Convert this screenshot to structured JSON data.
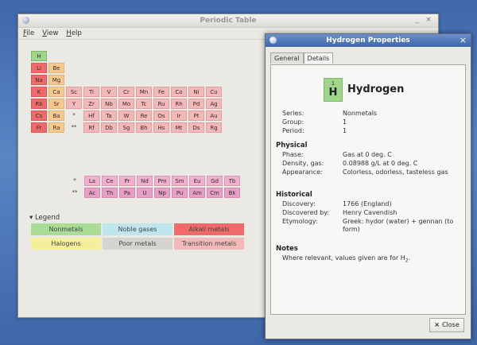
{
  "main_window": {
    "title": "Periodic Table",
    "menu": [
      "File",
      "View",
      "Help"
    ],
    "min_glyph": "_",
    "close_glyph": "×"
  },
  "table": {
    "rows": [
      [
        [
          "H",
          "nonmetal"
        ]
      ],
      [
        [
          "Li",
          "alkali"
        ],
        [
          "Be",
          "alkaline"
        ]
      ],
      [
        [
          "Na",
          "alkali"
        ],
        [
          "Mg",
          "alkaline"
        ]
      ],
      [
        [
          "K",
          "alkali"
        ],
        [
          "Ca",
          "alkaline"
        ],
        [
          "Sc",
          "transition"
        ],
        [
          "Ti",
          "transition"
        ],
        [
          "V",
          "transition"
        ],
        [
          "Cr",
          "transition"
        ],
        [
          "Mn",
          "transition"
        ],
        [
          "Fe",
          "transition"
        ],
        [
          "Co",
          "transition"
        ],
        [
          "Ni",
          "transition"
        ],
        [
          "Cu",
          "transition"
        ]
      ],
      [
        [
          "Rb",
          "alkali"
        ],
        [
          "Sr",
          "alkaline"
        ],
        [
          "Y",
          "transition"
        ],
        [
          "Zr",
          "transition"
        ],
        [
          "Nb",
          "transition"
        ],
        [
          "Mo",
          "transition"
        ],
        [
          "Tc",
          "transition"
        ],
        [
          "Ru",
          "transition"
        ],
        [
          "Rh",
          "transition"
        ],
        [
          "Pd",
          "transition"
        ],
        [
          "Ag",
          "transition"
        ]
      ],
      [
        [
          "Cs",
          "alkali"
        ],
        [
          "Ba",
          "alkaline"
        ],
        [
          "*",
          "blank"
        ],
        [
          "Hf",
          "transition"
        ],
        [
          "Ta",
          "transition"
        ],
        [
          "W",
          "transition"
        ],
        [
          "Re",
          "transition"
        ],
        [
          "Os",
          "transition"
        ],
        [
          "Ir",
          "transition"
        ],
        [
          "Pt",
          "transition"
        ],
        [
          "Au",
          "transition"
        ]
      ],
      [
        [
          "Fr",
          "alkali"
        ],
        [
          "Ra",
          "alkaline"
        ],
        [
          "**",
          "blank"
        ],
        [
          "Rf",
          "transition"
        ],
        [
          "Db",
          "transition"
        ],
        [
          "Sg",
          "transition"
        ],
        [
          "Bh",
          "transition"
        ],
        [
          "Hs",
          "transition"
        ],
        [
          "Mt",
          "transition"
        ],
        [
          "Ds",
          "transition"
        ],
        [
          "Rg",
          "transition"
        ]
      ]
    ],
    "lanthanides": [
      "*",
      "La",
      "Ce",
      "Pr",
      "Nd",
      "Pm",
      "Sm",
      "Eu",
      "Gd",
      "Tb"
    ],
    "actinides": [
      "**",
      "Ac",
      "Th",
      "Pa",
      "U",
      "Np",
      "Pu",
      "Am",
      "Cm",
      "Bk"
    ]
  },
  "legend": {
    "heading": "Legend",
    "items": [
      {
        "label": "Nonmetals",
        "color": "#a9dc95"
      },
      {
        "label": "Noble gases",
        "color": "#bfe6ef"
      },
      {
        "label": "Alkali metals",
        "color": "#ef6b6b"
      },
      {
        "label": "Halogens",
        "color": "#f5ef9c"
      },
      {
        "label": "Poor metals",
        "color": "#d6d4cf"
      },
      {
        "label": "Transition metals",
        "color": "#f3b8b8"
      }
    ]
  },
  "dialog": {
    "title": "Hydrogen Properties",
    "close_glyph": "×",
    "tabs": [
      "General",
      "Details"
    ],
    "element": {
      "number": "1",
      "symbol": "H",
      "name": "Hydrogen"
    },
    "basic": [
      {
        "label": "Series:",
        "value": "Nonmetals"
      },
      {
        "label": "Group:",
        "value": "1"
      },
      {
        "label": "Period:",
        "value": "1"
      }
    ],
    "physical_heading": "Physical",
    "physical": [
      {
        "label": "Phase:",
        "value": "Gas at 0 deg. C"
      },
      {
        "label": "Density, gas:",
        "value": "0.08988 g/L at 0 deg. C"
      },
      {
        "label": "Appearance:",
        "value": "Colorless, odorless, tasteless gas"
      }
    ],
    "historical_heading": "Historical",
    "historical": [
      {
        "label": "Discovery:",
        "value": "1766 (England)"
      },
      {
        "label": "Discovered by:",
        "value": "Henry Cavendish"
      },
      {
        "label": "Etymology:",
        "value": "Greek: hydor (water) + gennan (to form)"
      }
    ],
    "notes_heading": "Notes",
    "notes_text": "Where relevant, values given are for H",
    "notes_sub": "2",
    "notes_end": ".",
    "close_label": "Close",
    "close_icon": "×"
  }
}
